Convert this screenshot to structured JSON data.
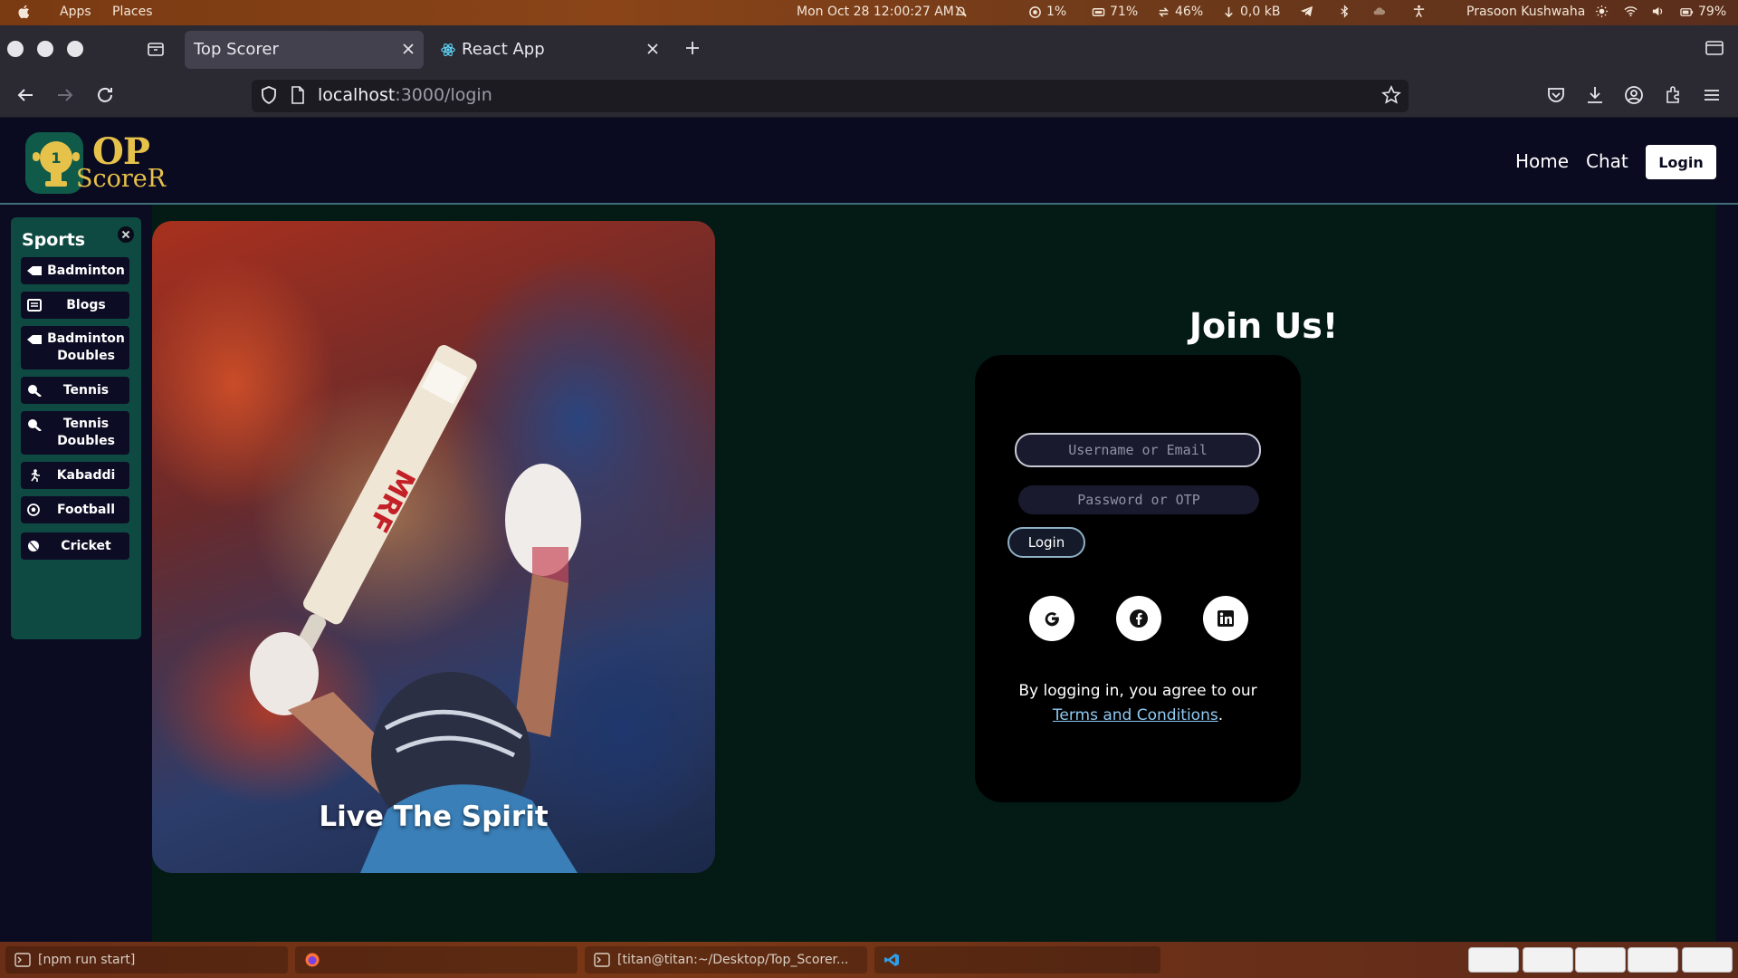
{
  "os_bar": {
    "menu_apps": "Apps",
    "menu_places": "Places",
    "clock": "Mon Oct 28  12:00:27 AM",
    "cpu": "1%",
    "memory": "71%",
    "swap": "46%",
    "net": "0,0 kB",
    "user": "Prasoon Kushwaha",
    "battery": "79%"
  },
  "browser": {
    "tabs": [
      {
        "label": "Top Scorer",
        "active": true
      },
      {
        "label": "React App",
        "active": false
      }
    ],
    "url_host": "localhost",
    "url_rest": ":3000/login"
  },
  "app": {
    "logo": {
      "line1": "OP",
      "line2": "ScoreR"
    },
    "nav": {
      "home": "Home",
      "chat": "Chat",
      "login": "Login"
    },
    "sidebar": {
      "title": "Sports",
      "items": [
        {
          "label": "Badminton",
          "icon": "shuttlecock-icon"
        },
        {
          "label": "Blogs",
          "icon": "newspaper-icon"
        },
        {
          "label": "Badminton Doubles",
          "icon": "shuttlecock-icon"
        },
        {
          "label": "Tennis",
          "icon": "tennis-racket-icon"
        },
        {
          "label": "Tennis Doubles",
          "icon": "tennis-racket-icon"
        },
        {
          "label": "Kabaddi",
          "icon": "running-person-icon"
        },
        {
          "label": "Football",
          "icon": "soccer-ball-icon"
        },
        {
          "label": "Cricket",
          "icon": "ball-icon"
        }
      ]
    },
    "hero": {
      "caption": "Live The Spirit"
    },
    "login_card": {
      "title": "Join Us!",
      "username_placeholder": "Username or Email",
      "password_placeholder": "Password or OTP",
      "submit": "Login",
      "agree_text": "By logging in, you agree to our",
      "terms_link": "Terms and Conditions",
      "terms_suffix": "."
    }
  },
  "taskbar": {
    "items": [
      {
        "label": "[npm run start]"
      },
      {
        "label": ""
      },
      {
        "label": "[titan@titan:~/Desktop/Top_Scorer..."
      },
      {
        "label": ""
      }
    ]
  }
}
